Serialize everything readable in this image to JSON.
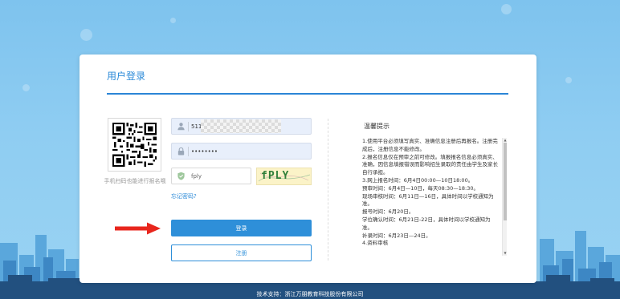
{
  "login": {
    "title": "用户登录",
    "username_value": "511",
    "password_value": "••••••••",
    "captcha_value": "fply",
    "captcha_image_text": "fPLY",
    "forgot_password": "忘记密码?",
    "login_button": "登录",
    "register_button": "注册"
  },
  "qr": {
    "caption": "手机扫码也能进行报名哦"
  },
  "tips": {
    "title": "温馨提示",
    "lines": [
      "1.使用平台必须填写真实、准确信息注册后再报名。注册完成后，注册信息不能修改。",
      "2.报名信息仅在预审之前可修改。填报报名信息必须真实、准确，因信息填报错误而影响招生录取的责任由学生及家长自行承担。",
      "3.网上报名时间：6月4日00:00—10日18:00。",
      "预审时间：6月4日—10日，每天08:30—18:30。",
      "现场审核时间：6月11日—16日，具体时间以学校通知为准。",
      "报号时间：6月20日。",
      "学位确认时间：6月21日-22日，具体时间以学校通知为准。",
      "补录时间：6月23日—24日。",
      "4.资料审核"
    ]
  },
  "footer": {
    "text": "技术支持：浙江万朋教育科技股份有限公司"
  },
  "colors": {
    "accent": "#2e8fd9",
    "field_bg": "#e8effb",
    "arrow": "#e8261d"
  },
  "icons": {
    "user": "user-icon",
    "lock": "lock-icon",
    "shield": "shield-check-icon",
    "arrow": "arrow-right-icon"
  }
}
